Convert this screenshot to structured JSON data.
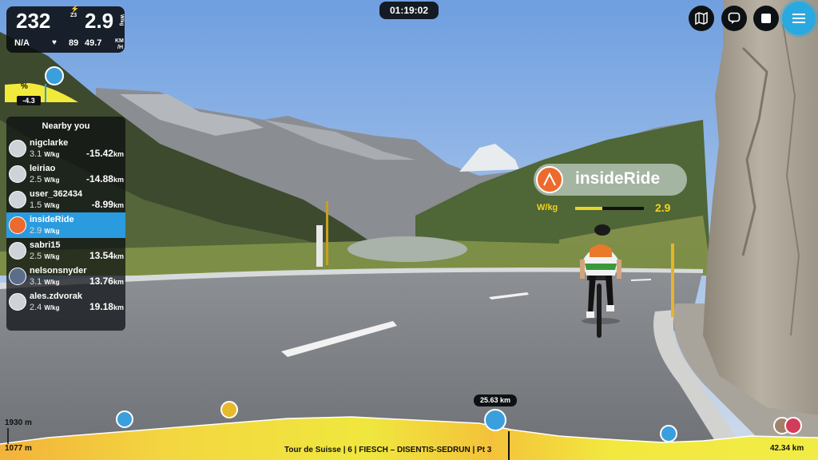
{
  "stats": {
    "power": "232",
    "power_zone": "Z3",
    "wkg": "2.9",
    "wkg_unit": "W/kg",
    "cadence": "N/A",
    "heart_rate": "89",
    "speed": "49.7",
    "speed_unit_top": "KM",
    "speed_unit_bottom": "/H"
  },
  "timer": "01:19:02",
  "gradient": {
    "symbol": "%",
    "value": "-4.3"
  },
  "nearby": {
    "title": "Nearby you",
    "wkg_unit": "W/kg",
    "dist_unit": "km",
    "riders": [
      {
        "name": "nigclarke",
        "wkg": "3.1",
        "gap": "-15.42"
      },
      {
        "name": "leiriao",
        "wkg": "2.5",
        "gap": "-14.88"
      },
      {
        "name": "user_362434",
        "wkg": "1.5",
        "gap": "-8.99"
      },
      {
        "name": "insideRide",
        "wkg": "2.9",
        "gap": ""
      },
      {
        "name": "sabri15",
        "wkg": "2.5",
        "gap": "13.54"
      },
      {
        "name": "nelsonsnyder",
        "wkg": "3.1",
        "gap": "13.76"
      },
      {
        "name": "ales.zdvorak",
        "wkg": "2.4",
        "gap": "19.18"
      }
    ]
  },
  "player_tag": {
    "name": "insideRide",
    "wkg_label": "W/kg",
    "wkg_value": "2.9",
    "wkg_fill_fraction": 0.4
  },
  "course": {
    "max_elevation": "1930 m",
    "min_elevation": "1077 m",
    "title": "Tour de Suisse | 6 | FIESCH – DISENTIS-SEDRUN | Pt 3",
    "current_distance": "25.63 km",
    "total_distance": "42.34 km"
  },
  "colors": {
    "accent": "#2b9be0",
    "gradient_yellow": "#f2ea3a",
    "wkg_yellow": "#f5d21a",
    "brand_orange": "#ec6a2e"
  },
  "icons": {
    "map": "map-icon",
    "chat": "chat-icon",
    "stop": "stop-icon",
    "menu": "menu-icon"
  }
}
